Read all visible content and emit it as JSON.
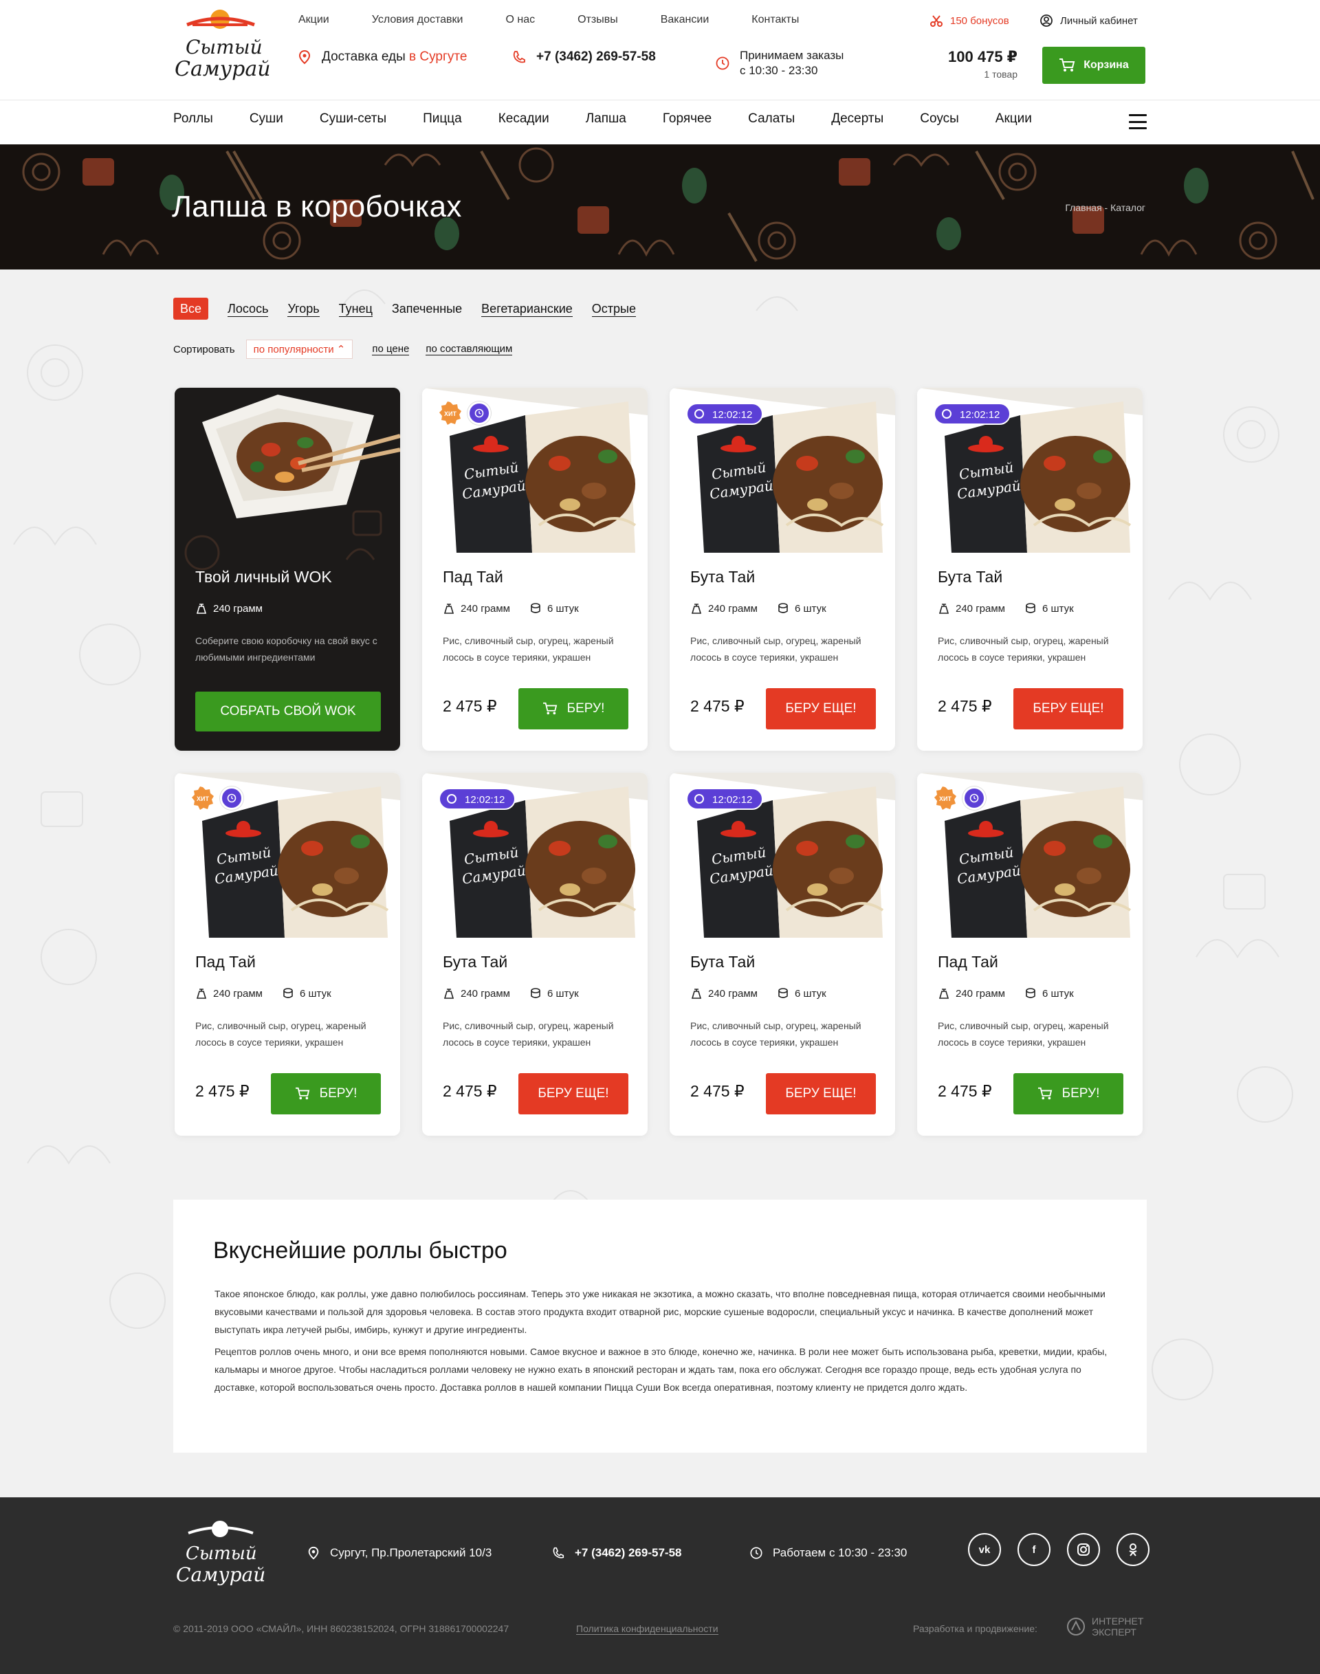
{
  "header": {
    "logo_text_1": "Сытый",
    "logo_text_2": "Самурай",
    "top_menu": [
      "Акции",
      "Условия доставки",
      "О нас",
      "Отзывы",
      "Вакансии",
      "Контакты"
    ],
    "bonus": "150 бонусов",
    "cabinet": "Личный кабинет",
    "delivery_prefix": "Доставка еды",
    "delivery_city": "в Сургуте",
    "phone": "+7 (3462) 269-57-58",
    "hours_line1": "Принимаем заказы",
    "hours_line2": "с 10:30 - 23:30",
    "cart_sum": "100 475 ₽",
    "cart_count": "1 товар",
    "cart_label": "Корзина",
    "nav": [
      "Роллы",
      "Суши",
      "Суши-сеты",
      "Пицца",
      "Кесадии",
      "Лапша",
      "Горячее",
      "Салаты",
      "Десерты",
      "Соусы",
      "Акции"
    ]
  },
  "banner": {
    "title": "Лапша в коробочках",
    "breadcrumbs": "Главная  -  Каталог"
  },
  "filters": [
    "Все",
    "Лосось",
    "Угорь",
    "Тунец",
    "Запеченные",
    "Вегетарианские",
    "Острые"
  ],
  "sort": {
    "label": "Сортировать",
    "popular": "по популярности",
    "price": "по цене",
    "composition": "по составляющим"
  },
  "wok": {
    "title": "Твой личный WOK",
    "weight": "240 грамм",
    "desc": "Соберите свою коробочку на свой вкус с любимыми ингредиентами",
    "button": "СОБРАТЬ СВОЙ WOK"
  },
  "products": [
    {
      "title": "Пад Тай",
      "weight": "240 грамм",
      "pieces": "6 штук",
      "desc": "Рис, сливочный сыр, огурец, жареный лосось в соусе терияки, украшен",
      "price": "2 475 ₽",
      "button": "БЕРУ!",
      "hit": "ХИТ",
      "timer": ""
    },
    {
      "title": "Бута Тай",
      "weight": "240 грамм",
      "pieces": "6 штук",
      "desc": "Рис, сливочный сыр, огурец, жареный лосось в соусе терияки, украшен",
      "price": "2 475 ₽",
      "button": "БЕРУ ЕЩЕ!",
      "hit": "",
      "timer": "12:02:12"
    },
    {
      "title": "Бута Тай",
      "weight": "240 грамм",
      "pieces": "6 штук",
      "desc": "Рис, сливочный сыр, огурец, жареный лосось в соусе терияки, украшен",
      "price": "2 475 ₽",
      "button": "БЕРУ ЕЩЕ!",
      "hit": "",
      "timer": "12:02:12"
    },
    {
      "title": "Пад Тай",
      "weight": "240 грамм",
      "pieces": "6 штук",
      "desc": "Рис, сливочный сыр, огурец, жареный лосось в соусе терияки, украшен",
      "price": "2 475 ₽",
      "button": "БЕРУ!",
      "hit": "ХИТ",
      "timer": ""
    },
    {
      "title": "Бута Тай",
      "weight": "240 грамм",
      "pieces": "6 штук",
      "desc": "Рис, сливочный сыр, огурец, жареный лосось в соусе терияки, украшен",
      "price": "2 475 ₽",
      "button": "БЕРУ ЕЩЕ!",
      "hit": "",
      "timer": "12:02:12"
    },
    {
      "title": "Бута Тай",
      "weight": "240 грамм",
      "pieces": "6 штук",
      "desc": "Рис, сливочный сыр, огурец, жареный лосось в соусе терияки, украшен",
      "price": "2 475 ₽",
      "button": "БЕРУ ЕЩЕ!",
      "hit": "",
      "timer": "12:02:12"
    },
    {
      "title": "Пад Тай",
      "weight": "240 грамм",
      "pieces": "6 штук",
      "desc": "Рис, сливочный сыр, огурец, жареный лосось в соусе терияки, украшен",
      "price": "2 475 ₽",
      "button": "БЕРУ!",
      "hit": "ХИТ",
      "timer": ""
    }
  ],
  "box_logo_1": "Сытый",
  "box_logo_2": "Самурай",
  "seo": {
    "title": "Вкуснейшие роллы быстро",
    "p1": "Такое японское блюдо, как роллы, уже давно полюбилось россиянам. Теперь это уже никакая не экзотика, а можно сказать, что вполне повседневная пища, которая отличается своими необычными вкусовыми качествами и пользой для здоровья человека. В состав этого продукта входит отварной рис, морские сушеные водоросли, специальный уксус и начинка. В качестве дополнений может выступать икра летучей рыбы, имбирь, кунжут и другие ингредиенты.",
    "p2": "Рецептов роллов очень много, и они все время пополняются новыми. Самое вкусное и важное в это блюде, конечно же, начинка. В роли нее может быть использована рыба, креветки, мидии, крабы, кальмары и многое другое. Чтобы насладиться роллами человеку не нужно ехать в японский ресторан и ждать там, пока его обслужат. Сегодня все гораздо проще, ведь есть удобная услуга по доставке, которой воспользоваться очень просто. Доставка роллов в нашей компании Пицца Суши Вок всегда оперативная, поэтому клиенту не придется долго ждать."
  },
  "footer": {
    "address": "Сургут, Пр.Пролетарский 10/3",
    "phone": "+7 (3462) 269-57-58",
    "hours": "Работаем с 10:30 - 23:30",
    "socials": [
      "vk",
      "f",
      "ig",
      "ok"
    ],
    "copyright": "© 2011-2019   ООО «СМАЙЛ», ИНН 860238152024, ОГРН 318861700002247",
    "policy": "Политика конфиденциальности",
    "dev_label": "Разработка и продвижение:",
    "dev_name_1": "ИНТЕРНЕТ",
    "dev_name_2": "ЭКСПЕРТ"
  },
  "colors": {
    "accent_red": "#e43a24",
    "accent_green": "#3a9a1f",
    "badge_purple": "#5b3fd6",
    "footer_bg": "#2d2d2d"
  }
}
